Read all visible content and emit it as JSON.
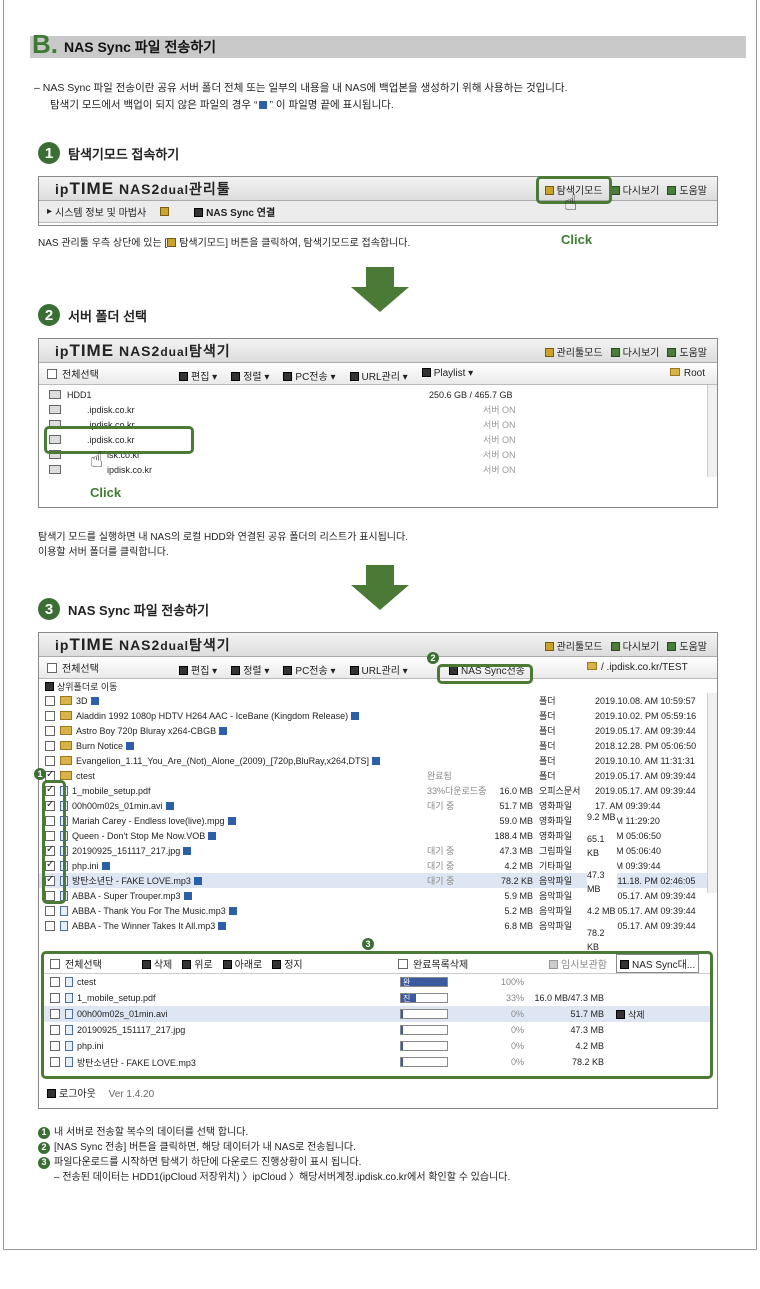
{
  "section": {
    "letter": "B.",
    "title": "NAS Sync 파일 전송하기"
  },
  "intro": [
    "– NAS Sync 파일 전송이란 공유 서버 폴더 전체 또는 일부의 내용을 내 NAS에 백업본을 생성하기 위해 사용하는 것입니다.",
    "탐색기 모드에서 백업이 되지 않은 파일의 경우 “",
    "” 이 파일명 끝에 표시됩니다."
  ],
  "logo": {
    "ip": "ip",
    "time": "TIME",
    "nas": "NAS2",
    "dual": "dual"
  },
  "click": "Click",
  "step1": {
    "num": "1",
    "title": "탐색기모드 접속하기",
    "sub": "관리툴",
    "links": [
      "탐색기모드",
      "다시보기",
      "도움말"
    ],
    "menu": "시스템 정보 및 마법사",
    "tab": "NAS Sync 연결",
    "note": "NAS 관리툴 우측 상단에 있는 [",
    "note_btn": "탐색기모드",
    "note_end": "] 버튼을 클릭하여, 탐색기모드로 접속합니다."
  },
  "step2": {
    "num": "2",
    "title": "서버 폴더 선택",
    "sub": "탐색기",
    "links": [
      "관리툴모드",
      "다시보기",
      "도움말"
    ],
    "toolbar": {
      "selectall": "전체선택",
      "items": [
        "편집 ▾",
        "정렬 ▾",
        "PC전송 ▾",
        "URL관리 ▾",
        "Playlist ▾"
      ],
      "root": "Root"
    },
    "rows": [
      {
        "name": "HDD1",
        "size": "250.6 GB / 465.7 GB",
        "status": ""
      },
      {
        "name": ".ipdisk.co.kr",
        "size": "",
        "status": "서버 ON"
      },
      {
        "name": ".ipdisk.co.kr",
        "size": "",
        "status": "서버 ON"
      },
      {
        "name": ".ipdisk.co.kr",
        "size": "",
        "status": "서버 ON"
      },
      {
        "name": "isk.co.kr",
        "size": "",
        "status": "서버 ON"
      },
      {
        "name": "ipdisk.co.kr",
        "size": "",
        "status": "서버 ON"
      }
    ],
    "note": [
      "탐색기 모드를 실행하면 내 NAS의 로컬 HDD와 연결된 공유 폴더의 리스트가 표시됩니다.",
      "이용할 서버 폴더를 클릭합니다."
    ]
  },
  "step3": {
    "num": "3",
    "title": "NAS Sync 파일 전송하기",
    "sub": "탐색기",
    "links": [
      "관리툴모드",
      "다시보기",
      "도움말"
    ],
    "toolbar": {
      "selectall": "전체선택",
      "items": [
        "편집 ▾",
        "정렬 ▾",
        "PC전송 ▾",
        "URL관리 ▾"
      ],
      "sync": "NAS Sync전송",
      "path": "/       .ipdisk.co.kr/TEST"
    },
    "up": "상위폴더로 이동",
    "files": [
      {
        "n": "3D",
        "s": "",
        "z": "",
        "t": "폴더",
        "d": "2019.10.08. AM 10:59:57",
        "c": false,
        "f": true
      },
      {
        "n": "Aladdin 1992 1080p HDTV H264 AAC - IceBane (Kingdom Release)",
        "s": "",
        "z": "",
        "t": "폴더",
        "d": "2019.10.02. PM 05:59:16",
        "c": false,
        "f": true
      },
      {
        "n": "Astro Boy 720p Bluray x264-CBGB",
        "s": "",
        "z": "",
        "t": "폴더",
        "d": "2019.05.17. AM 09:39:44",
        "c": false,
        "f": true
      },
      {
        "n": "Burn Notice",
        "s": "",
        "z": "",
        "t": "폴더",
        "d": "2018.12.28. PM 05:06:50",
        "c": false,
        "f": true
      },
      {
        "n": "Evangelion_1.11_You_Are_(Not)_Alone_(2009)_[720p,BluRay,x264,DTS]",
        "s": "",
        "z": "",
        "t": "폴더",
        "d": "2019.10.10. AM 11:31:31",
        "c": false,
        "f": true
      },
      {
        "n": "ctest",
        "s": "완료됨",
        "z": "",
        "t": "폴더",
        "d": "2019.05.17. AM 09:39:44",
        "c": true,
        "f": true
      },
      {
        "n": "1_mobile_setup.pdf",
        "s": "33%다운로드중",
        "z": "16.0 MB",
        "t": "오피스문서",
        "d": "2019.05.17. AM 09:39:44",
        "c": true,
        "f": false
      },
      {
        "n": "00h00m02s_01min.avi",
        "s": "대기 중",
        "z": "51.7 MB",
        "t": "영화파일",
        "d": "17. AM 09:39:44",
        "c": true,
        "f": false
      },
      {
        "n": "Mariah Carey - Endless love(live).mpg",
        "s": "",
        "z": "59.0 MB",
        "t": "영화파일",
        "d": "21. AM 11:29:20",
        "c": false,
        "f": false
      },
      {
        "n": "Queen - Don't Stop Me Now.VOB",
        "s": "",
        "z": "188.4 MB",
        "t": "영화파일",
        "d": "28. PM 05:06:50",
        "c": false,
        "f": false
      },
      {
        "n": "20190925_151117_217.jpg",
        "s": "대기 중",
        "z": "47.3 MB",
        "t": "그림파일",
        "d": "28. PM 05:06:40",
        "c": true,
        "f": false
      },
      {
        "n": "php.ini",
        "s": "대기 중",
        "z": "4.2 MB",
        "t": "기타파일",
        "d": "17. AM 09:39:44",
        "c": true,
        "f": false
      },
      {
        "n": "방탄소년단 - FAKE LOVE.mp3",
        "s": "대기 중",
        "z": "78.2 KB",
        "t": "음악파일",
        "d": "2019.11.18. PM 02:46:05",
        "c": true,
        "f": false
      },
      {
        "n": "ABBA - Super Trouper.mp3",
        "s": "",
        "z": "5.9 MB",
        "t": "음악파일",
        "d": "2019.05.17. AM 09:39:44",
        "c": false,
        "f": false
      },
      {
        "n": "ABBA - Thank You For The Music.mp3",
        "s": "",
        "z": "5.2 MB",
        "t": "음악파일",
        "d": "2019.05.17. AM 09:39:44",
        "c": false,
        "f": false
      },
      {
        "n": "ABBA - The Winner Takes It All.mp3",
        "s": "",
        "z": "6.8 MB",
        "t": "음악파일",
        "d": "2019.05.17. AM 09:39:44",
        "c": false,
        "f": false
      }
    ],
    "popup": [
      "9.2 MB",
      "65.1 KB",
      "47.3 MB",
      "4.2 MB",
      "78.2 KB"
    ],
    "panel": {
      "selectall": "전체선택",
      "btns": [
        "삭제",
        "위로",
        "아래로",
        "정지"
      ],
      "clear": "완료목록삭제",
      "tab1": "임시보관함",
      "tab2": "NAS Sync대..."
    },
    "queue": [
      {
        "n": "ctest",
        "p": "완",
        "pct": "100%",
        "z": "",
        "fill": 1
      },
      {
        "n": "1_mobile_setup.pdf",
        "p": "진",
        "pct": "33%",
        "z": "16.0 MB/47.3 MB",
        "fill": 0.33
      },
      {
        "n": "00h00m02s_01min.avi",
        "p": "대",
        "pct": "0%",
        "z": "51.7 MB",
        "fill": 0
      },
      {
        "n": "20190925_151117_217.jpg",
        "p": "대",
        "pct": "0%",
        "z": "47.3 MB",
        "fill": 0
      },
      {
        "n": "php.ini",
        "p": "대",
        "pct": "0%",
        "z": "4.2 MB",
        "fill": 0
      },
      {
        "n": "방탄소년단 - FAKE LOVE.mp3",
        "p": "대",
        "pct": "0%",
        "z": "78.2 KB",
        "fill": 0
      }
    ],
    "del": "삭제",
    "logout": "로그아웃",
    "ver": "Ver 1.4.20"
  },
  "footer": [
    "내 서버로 전송할 복수의 데이터를 선택 합니다.",
    "[NAS Sync 전송] 버튼을 클릭하면, 해당 데이터가 내 NAS로 전송됩니다.",
    "파일다운로드를 시작하면 탐색기 하단에 다운로드 진행상황이 표시 됩니다.",
    "– 전송된 데이터는 HDD1(ipCloud 저장위치) 〉ipCloud 〉해당서버계정.ipdisk.co.kr에서 확인할 수 있습니다."
  ]
}
